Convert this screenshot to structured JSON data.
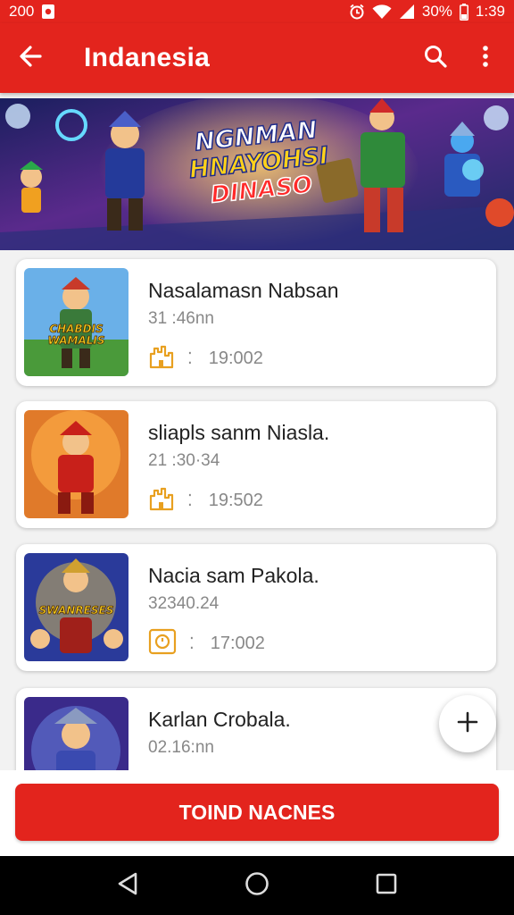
{
  "status_bar": {
    "left_text": "200",
    "battery": "30%",
    "time": "1:39",
    "icons": [
      "notification-icon",
      "alarm-icon",
      "wifi-icon",
      "signal-icon",
      "battery-icon"
    ]
  },
  "app_bar": {
    "title": "Indanesia",
    "icons": [
      "back-arrow-icon",
      "search-icon",
      "more-vert-icon"
    ]
  },
  "banner": {
    "line1": "NGNMAN",
    "line2": "HNAYOHSI",
    "line3": "DINASO"
  },
  "list": {
    "items": [
      {
        "name": "Nasalamasn Nabsan",
        "time": "31 :46nn",
        "value": "19:002",
        "icon": "castle-icon",
        "thumb_label": "CHABDIS WAMALIS"
      },
      {
        "name": "sliapls sanm Niasla.",
        "time": "21 :30·34",
        "value": "19:502",
        "icon": "castle-icon",
        "thumb_label": ""
      },
      {
        "name": "Nacia sam Pakola.",
        "time": "32340.24",
        "value": "17:002",
        "icon": "timer-icon",
        "thumb_label": "SWANRESES"
      },
      {
        "name": "Karlan Crobala.",
        "time": "02.16:nn",
        "value": "",
        "icon": "",
        "thumb_label": ""
      }
    ]
  },
  "fab": {
    "icon": "plus-icon"
  },
  "bottom_button": {
    "label": "TOIND NACNES"
  },
  "nav_bar": {
    "icons": [
      "nav-back-icon",
      "nav-home-icon",
      "nav-recents-icon"
    ]
  },
  "colors": {
    "primary": "#e3241d",
    "icon_accent": "#e8a020"
  }
}
